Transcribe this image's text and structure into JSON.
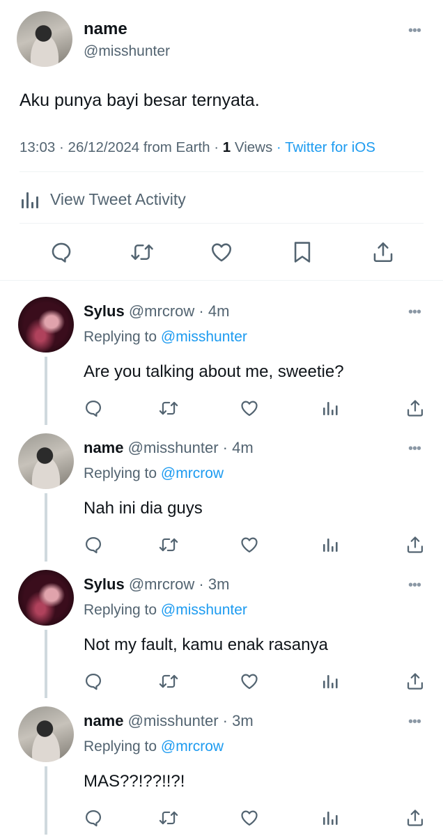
{
  "main_tweet": {
    "name": "name",
    "handle": "@misshunter",
    "text": "Aku punya bayi besar ternyata.",
    "time": "13:03",
    "date": "26/12/2024 from Earth",
    "views_count": "1",
    "views_label": "Views",
    "source": "Twitter for iOS",
    "activity_label": "View Tweet Activity"
  },
  "separator": "·",
  "replying_label": "Replying to",
  "replies": [
    {
      "name": "Sylus",
      "handle": "@mrcrow",
      "time": "4m",
      "replying_to": "@misshunter",
      "text": "Are you talking about me, sweetie?",
      "avatar": "avatar-sylus"
    },
    {
      "name": "name",
      "handle": "@misshunter",
      "time": "4m",
      "replying_to": "@mrcrow",
      "text": "Nah ini dia guys",
      "avatar": "avatar-misshunter"
    },
    {
      "name": "Sylus",
      "handle": "@mrcrow",
      "time": "3m",
      "replying_to": "@misshunter",
      "text": "Not my fault, kamu enak rasanya",
      "avatar": "avatar-sylus"
    },
    {
      "name": "name",
      "handle": "@misshunter",
      "time": "3m",
      "replying_to": "@mrcrow",
      "text": "MAS??!??!!?!",
      "avatar": "avatar-misshunter"
    }
  ],
  "icons": [
    "reply-icon",
    "retweet-icon",
    "like-icon",
    "bookmark-icon",
    "share-icon",
    "views-icon",
    "more-icon",
    "activity-icon"
  ],
  "colors": {
    "text": "#0f1419",
    "secondary": "#536471",
    "link": "#1d9bf0",
    "divider": "#eff3f4",
    "thread_line": "#cfd9de"
  }
}
